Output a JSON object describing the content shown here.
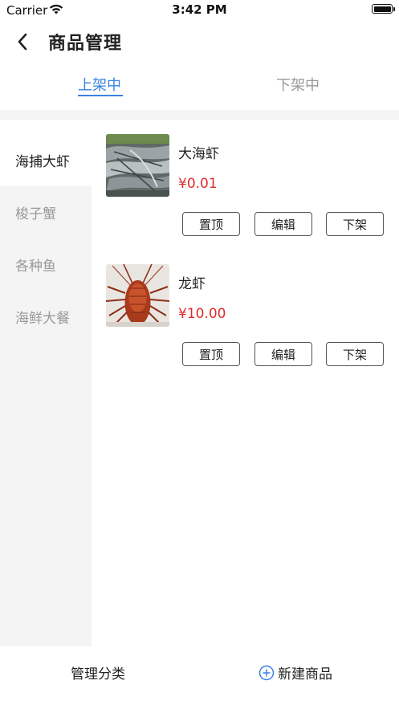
{
  "status_bar": {
    "carrier": "Carrier",
    "time": "3:42 PM"
  },
  "header": {
    "title": "商品管理",
    "back_icon": "chevron-left-icon"
  },
  "tabs": [
    {
      "label": "上架中",
      "active": true
    },
    {
      "label": "下架中",
      "active": false
    }
  ],
  "sidebar": {
    "items": [
      {
        "label": "海捕大虾",
        "active": true
      },
      {
        "label": "梭子蟹",
        "active": false
      },
      {
        "label": "各种鱼",
        "active": false
      },
      {
        "label": "海鲜大餐",
        "active": false
      }
    ]
  },
  "products": [
    {
      "name": "大海虾",
      "price": "¥0.01",
      "actions": {
        "top": "置顶",
        "edit": "编辑",
        "off": "下架"
      }
    },
    {
      "name": "龙虾",
      "price": "¥10.00",
      "actions": {
        "top": "置顶",
        "edit": "编辑",
        "off": "下架"
      }
    }
  ],
  "bottom_bar": {
    "manage_label": "管理分类",
    "new_label": "新建商品",
    "new_icon": "plus-circle-icon"
  },
  "colors": {
    "accent": "#3a83e0",
    "price": "#e02b2b",
    "sidebar_bg": "#f4f4f4"
  }
}
